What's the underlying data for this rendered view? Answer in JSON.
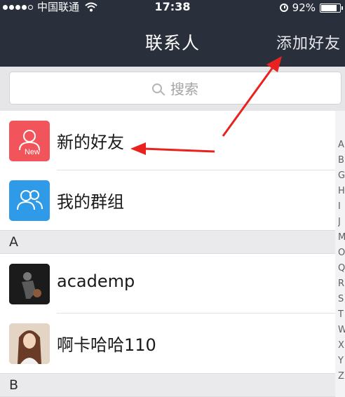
{
  "status_bar": {
    "carrier": "中国联通",
    "time": "17:38",
    "battery": "92%",
    "battery_level": 0.92
  },
  "nav": {
    "title": "联系人",
    "add_friend": "添加好友"
  },
  "search": {
    "placeholder": "搜索"
  },
  "special_items": [
    {
      "label": "新的好友",
      "icon": "new-friend-icon",
      "badge": "New",
      "color": "#f2545b"
    },
    {
      "label": "我的群组",
      "icon": "group-icon",
      "color": "#2f9be8"
    }
  ],
  "sections": [
    {
      "letter": "A",
      "contacts": [
        {
          "name": "academp"
        },
        {
          "name": "啊卡哈哈110"
        }
      ]
    },
    {
      "letter": "B"
    }
  ],
  "index_letters": [
    "A",
    "B",
    "G",
    "H",
    "I",
    "J",
    "M",
    "O",
    "Q",
    "R",
    "S",
    "T",
    "W",
    "X",
    "Y",
    "Z"
  ]
}
